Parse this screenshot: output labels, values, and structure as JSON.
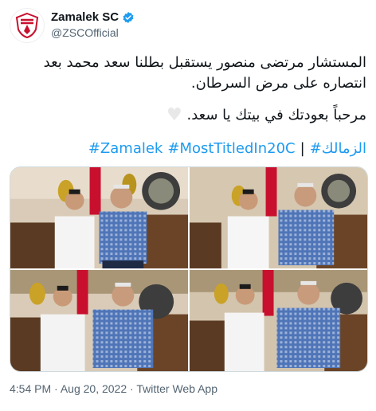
{
  "account": {
    "display_name": "Zamalek SC",
    "handle": "@ZSCOfficial",
    "verified": true,
    "avatar_icon": "zamalek-crest-icon"
  },
  "tweet": {
    "line1": "المستشار مرتضى منصور يستقبل بطلنا سعد محمد بعد انتصاره على مرض السرطان.",
    "line2": "مرحباً بعودتك في بيتك يا سعد.",
    "heart_icon": "white-heart-icon",
    "hashtags": {
      "arabic": "#الزمالك",
      "separator": "|",
      "tag1": "#MostTitledIn20C",
      "tag2": "#Zamalek"
    }
  },
  "media": {
    "photo_count": 4
  },
  "meta": {
    "time": "4:54 PM",
    "dot1": "·",
    "date": "Aug 20, 2022",
    "dot2": "·",
    "source": "Twitter Web App"
  },
  "colors": {
    "link": "#1d9bf0",
    "secondary_text": "#536471",
    "primary_text": "#0f1419",
    "crest_red": "#c8102e"
  }
}
